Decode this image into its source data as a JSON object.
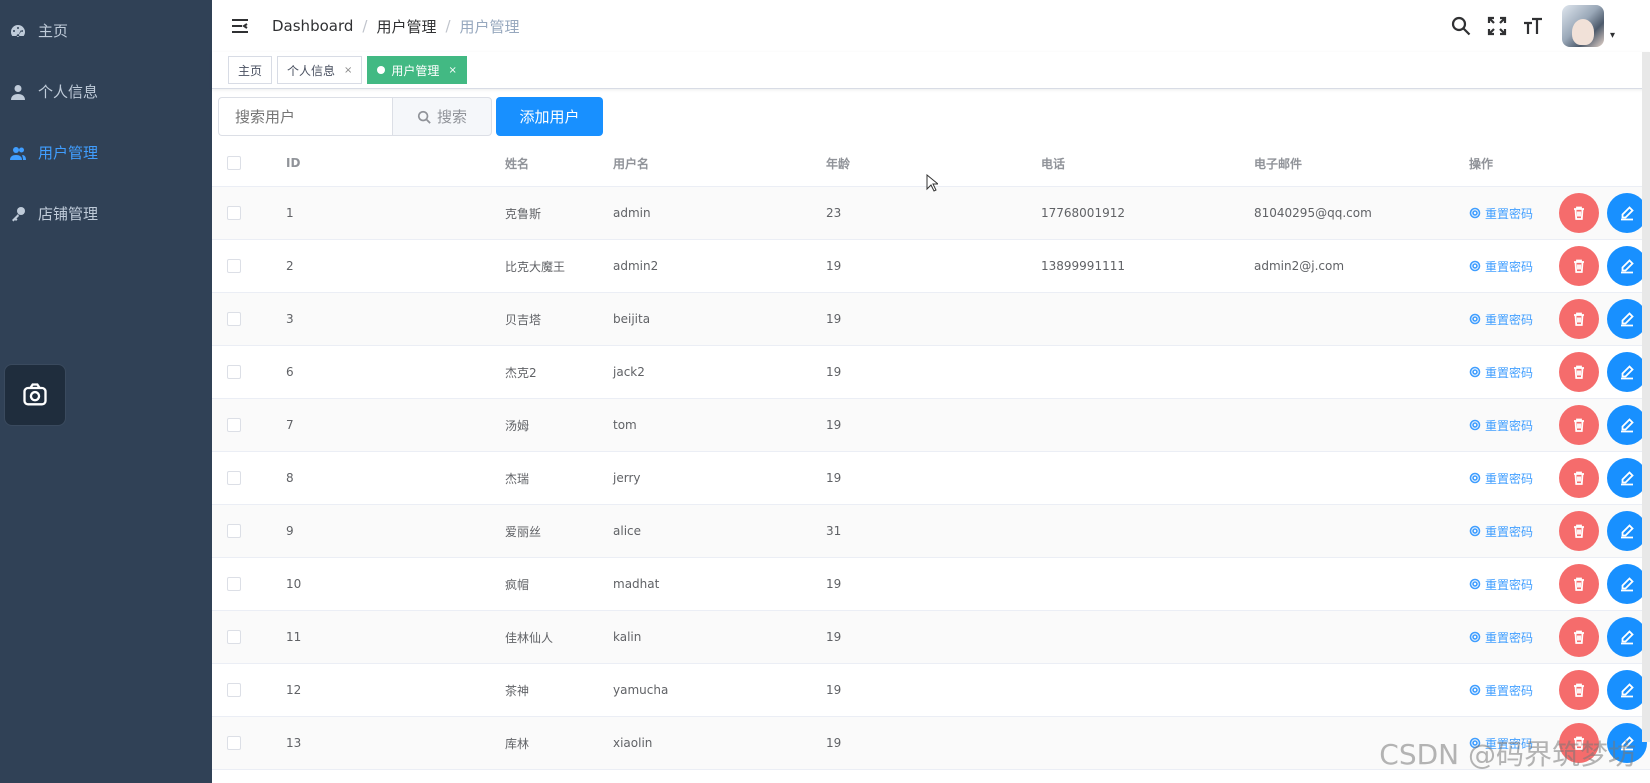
{
  "sidebar": {
    "items": [
      {
        "label": "主页",
        "icon": "dashboard-icon",
        "active": false
      },
      {
        "label": "个人信息",
        "icon": "user-icon",
        "active": false
      },
      {
        "label": "用户管理",
        "icon": "users-icon",
        "active": true
      },
      {
        "label": "店铺管理",
        "icon": "key-icon",
        "active": false
      }
    ]
  },
  "navbar": {
    "breadcrumb": [
      "Dashboard",
      "用户管理",
      "用户管理"
    ]
  },
  "tags": [
    {
      "label": "主页",
      "closable": false,
      "active": false
    },
    {
      "label": "个人信息",
      "closable": true,
      "active": false
    },
    {
      "label": "用户管理",
      "closable": true,
      "active": true
    }
  ],
  "toolbar": {
    "search_placeholder": "搜索用户",
    "search_label": "搜索",
    "add_label": "添加用户"
  },
  "table": {
    "headers": {
      "id": "ID",
      "name": "姓名",
      "username": "用户名",
      "age": "年龄",
      "phone": "电话",
      "email": "电子邮件",
      "ops": "操作"
    },
    "reset_label": "重置密码",
    "rows": [
      {
        "id": "1",
        "name": "克鲁斯",
        "username": "admin",
        "age": "23",
        "phone": "17768001912",
        "email": "81040295@qq.com"
      },
      {
        "id": "2",
        "name": "比克大魔王",
        "username": "admin2",
        "age": "19",
        "phone": "13899991111",
        "email": "admin2@j.com"
      },
      {
        "id": "3",
        "name": "贝吉塔",
        "username": "beijita",
        "age": "19",
        "phone": "",
        "email": ""
      },
      {
        "id": "6",
        "name": "杰克2",
        "username": "jack2",
        "age": "19",
        "phone": "",
        "email": ""
      },
      {
        "id": "7",
        "name": "汤姆",
        "username": "tom",
        "age": "19",
        "phone": "",
        "email": ""
      },
      {
        "id": "8",
        "name": "杰瑞",
        "username": "jerry",
        "age": "19",
        "phone": "",
        "email": ""
      },
      {
        "id": "9",
        "name": "爱丽丝",
        "username": "alice",
        "age": "31",
        "phone": "",
        "email": ""
      },
      {
        "id": "10",
        "name": "疯帽",
        "username": "madhat",
        "age": "19",
        "phone": "",
        "email": ""
      },
      {
        "id": "11",
        "name": "佳林仙人",
        "username": "kalin",
        "age": "19",
        "phone": "",
        "email": ""
      },
      {
        "id": "12",
        "name": "茶神",
        "username": "yamucha",
        "age": "19",
        "phone": "",
        "email": ""
      },
      {
        "id": "13",
        "name": "库林",
        "username": "xiaolin",
        "age": "19",
        "phone": "",
        "email": ""
      }
    ]
  },
  "watermark": "CSDN @码界筑梦坊"
}
